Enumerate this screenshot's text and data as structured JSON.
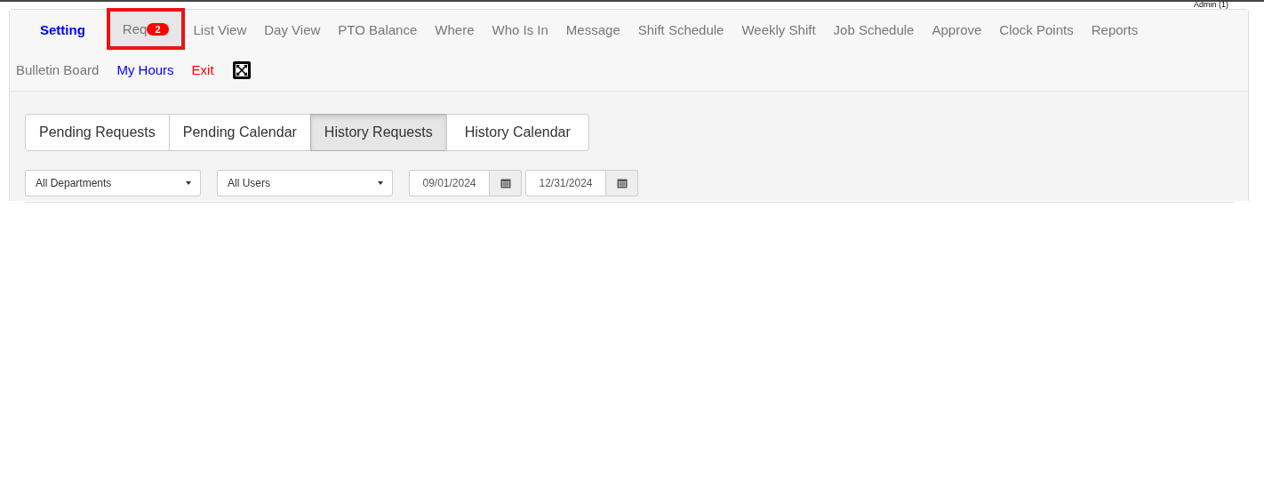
{
  "user_label": "Admin (1)",
  "nav": [
    {
      "label": "Setting",
      "kind": "primary",
      "selected": false
    },
    {
      "label": "Req",
      "kind": "normal",
      "selected": true,
      "badge": "2"
    },
    {
      "label": "List View",
      "kind": "normal",
      "selected": false
    },
    {
      "label": "Day View",
      "kind": "normal",
      "selected": false
    },
    {
      "label": "PTO Balance",
      "kind": "normal",
      "selected": false
    },
    {
      "label": "Where",
      "kind": "normal",
      "selected": false
    },
    {
      "label": "Who Is In",
      "kind": "normal",
      "selected": false
    },
    {
      "label": "Message",
      "kind": "normal",
      "selected": false
    },
    {
      "label": "Shift Schedule",
      "kind": "normal",
      "selected": false
    },
    {
      "label": "Weekly Shift",
      "kind": "normal",
      "selected": false
    },
    {
      "label": "Job Schedule",
      "kind": "normal",
      "selected": false
    },
    {
      "label": "Approve",
      "kind": "normal",
      "selected": false
    },
    {
      "label": "Clock Points",
      "kind": "normal",
      "selected": false
    },
    {
      "label": "Reports",
      "kind": "normal",
      "selected": false
    },
    {
      "label": "Bulletin Board",
      "kind": "normal",
      "selected": false
    },
    {
      "label": "My Hours",
      "kind": "link",
      "selected": false
    },
    {
      "label": "Exit",
      "kind": "exit",
      "selected": false
    },
    {
      "kind": "fullscreen",
      "selected": false
    }
  ],
  "tabs": [
    {
      "label": "Pending Requests",
      "selected": false
    },
    {
      "label": "Pending Calendar",
      "selected": false
    },
    {
      "label": "History Requests",
      "selected": true
    },
    {
      "label": "History Calendar",
      "selected": false
    }
  ],
  "filters": {
    "department": "All Departments",
    "user": "All Users",
    "start_date": "09/01/2024",
    "end_date": "12/31/2024"
  }
}
